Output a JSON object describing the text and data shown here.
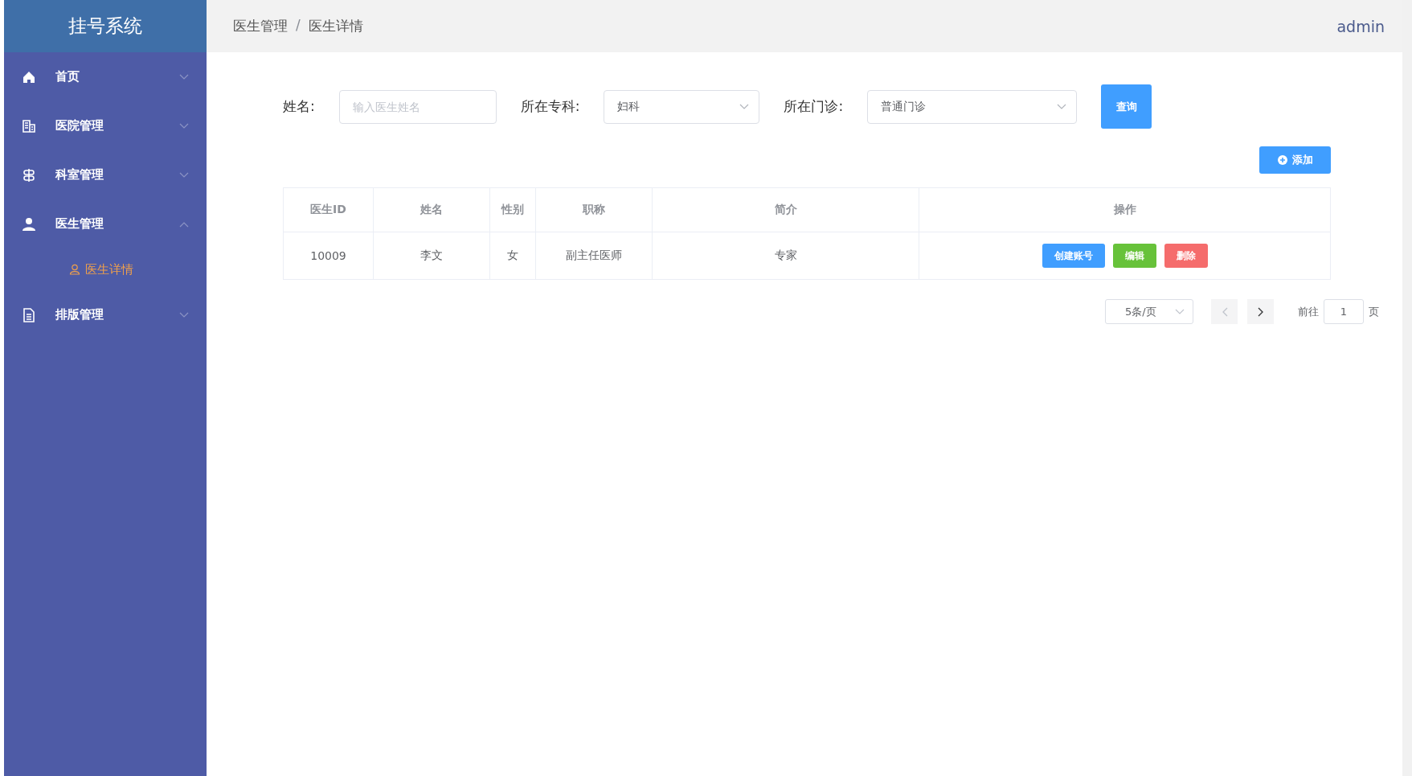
{
  "sidebar": {
    "title": "挂号系统",
    "items": [
      {
        "label": "首页",
        "expanded": false
      },
      {
        "label": "医院管理",
        "expanded": false
      },
      {
        "label": "科室管理",
        "expanded": false
      },
      {
        "label": "医生管理",
        "expanded": true,
        "children": [
          {
            "label": "医生详情",
            "selected": true
          }
        ]
      },
      {
        "label": "排版管理",
        "expanded": false
      }
    ]
  },
  "header": {
    "breadcrumb": [
      "医生管理",
      "医生详情"
    ],
    "separator": "/",
    "user": "admin"
  },
  "filters": [
    {
      "kind": "input",
      "label": "姓名:",
      "placeholder": "输入医生姓名"
    },
    {
      "kind": "select",
      "label": "所在专科:",
      "value": "妇科"
    },
    {
      "kind": "select",
      "label": "所在门诊:",
      "value": "普通门诊"
    }
  ],
  "query_button": "查询",
  "add_button": "添加",
  "table": {
    "columns": [
      "医生ID",
      "姓名",
      "性别",
      "职称",
      "简介",
      "操作"
    ],
    "rows": [
      {
        "cells": [
          "10009",
          "李文",
          "女",
          "副主任医师",
          "专家"
        ],
        "actions": [
          {
            "label": "创建账号",
            "kind": "primary"
          },
          {
            "label": "编辑",
            "kind": "success"
          },
          {
            "label": "删除",
            "kind": "danger"
          }
        ]
      }
    ]
  },
  "pagination": {
    "page_size": "5条/页",
    "prev_disabled": true,
    "next_disabled": false,
    "goto_label": "前往",
    "page": "1",
    "page_suffix": "页"
  }
}
